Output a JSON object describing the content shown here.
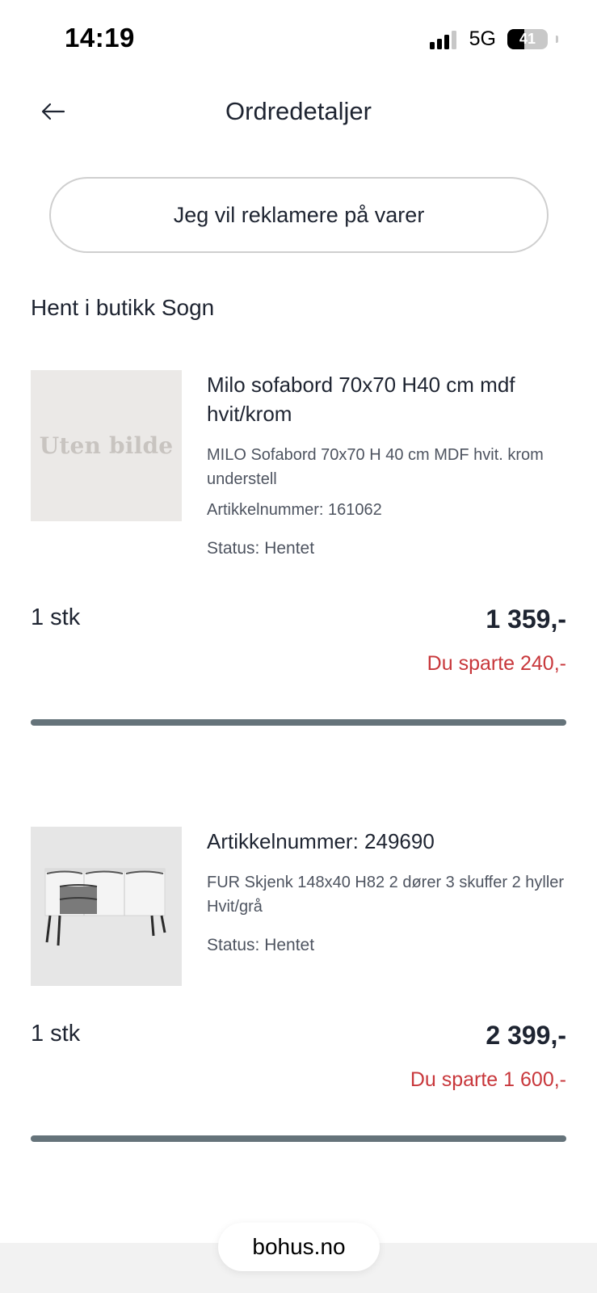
{
  "status_bar": {
    "time": "14:19",
    "network": "5G",
    "battery_level": "41"
  },
  "header": {
    "back_icon": "arrow-left-icon",
    "title": "Ordredetaljer"
  },
  "complaint_button": {
    "label": "Jeg vil reklamere på varer"
  },
  "section": {
    "title": "Hent i butikk Sogn"
  },
  "items": [
    {
      "image_placeholder": "Uten bilde",
      "name": "Milo sofabord 70x70 H40 cm mdf hvit/krom",
      "description": "MILO Sofabord 70x70 H 40 cm MDF hvit. krom understell",
      "article": "Artikkelnummer: 161062",
      "status": "Status: Hentet",
      "quantity": "1 stk",
      "price": "1 359,-",
      "saved": "Du sparte 240,-"
    },
    {
      "image_alt": "sideboard-image",
      "name": "Artikkelnummer: 249690",
      "description": "FUR Skjenk 148x40 H82 2 dører 3 skuffer 2 hyller Hvit/grå",
      "status": "Status: Hentet",
      "quantity": "1 stk",
      "price": "2 399,-",
      "saved": "Du sparte 1 600,-"
    }
  ],
  "footer": {
    "url": "bohus.no"
  },
  "colors": {
    "text": "#1e2431",
    "muted": "#4e5460",
    "saving": "#c8373b",
    "divider": "#65737a",
    "thumb_bg": "#ebe9e7"
  }
}
